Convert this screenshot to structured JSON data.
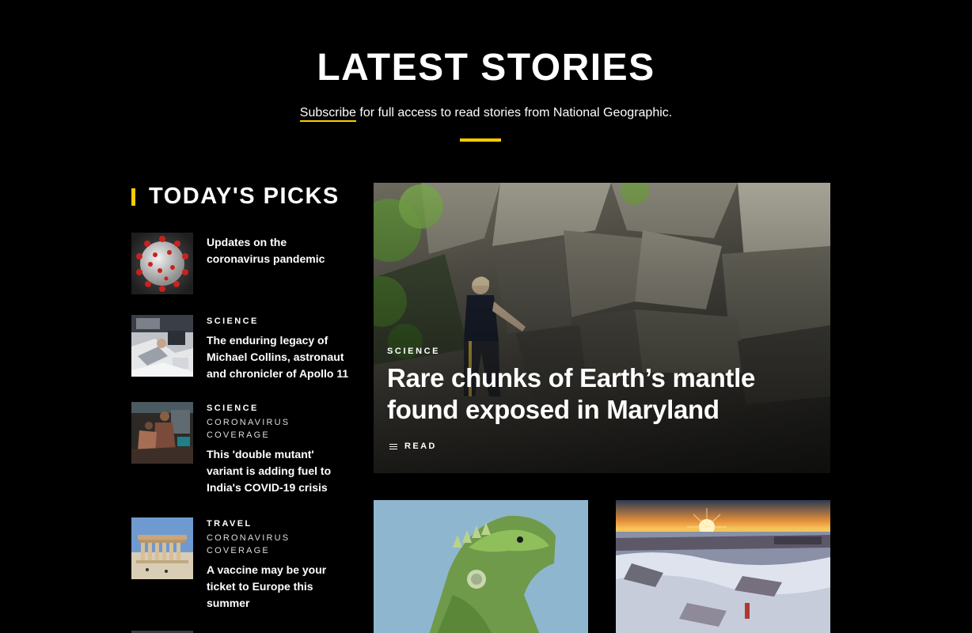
{
  "header": {
    "title": "LATEST STORIES",
    "subscribe_link": "Subscribe",
    "subscribe_text": " for full access to read stories from National Geographic."
  },
  "picks": {
    "heading": "TODAY'S PICKS",
    "items": [
      {
        "kicker": "",
        "subkicker": "",
        "title": "Updates on the coronavirus pandemic",
        "image": "coronavirus-illustration"
      },
      {
        "kicker": "SCIENCE",
        "subkicker": "",
        "title": "The enduring legacy of Michael Collins, astronaut and chronicler of Apollo 11",
        "image": "astronaut-photo"
      },
      {
        "kicker": "SCIENCE",
        "subkicker": "CORONAVIRUS COVERAGE",
        "title": "This 'double mutant' variant is adding fuel to India's COVID-19 crisis",
        "image": "hospital-photo"
      },
      {
        "kicker": "TRAVEL",
        "subkicker": "CORONAVIRUS COVERAGE",
        "title": "A vaccine may be your ticket to Europe this summer",
        "image": "parthenon-photo"
      }
    ]
  },
  "feature": {
    "kicker": "SCIENCE",
    "title": "Rare chunks of Earth’s mantle found exposed in Maryland",
    "read_label": "READ",
    "image": "rock-outcrop-photo"
  },
  "cards": [
    {
      "image": "iguana-photo"
    },
    {
      "image": "snowy-sunset-landscape-photo"
    }
  ],
  "colors": {
    "background": "#000000",
    "accent": "#ffcc00",
    "text": "#ffffff"
  }
}
